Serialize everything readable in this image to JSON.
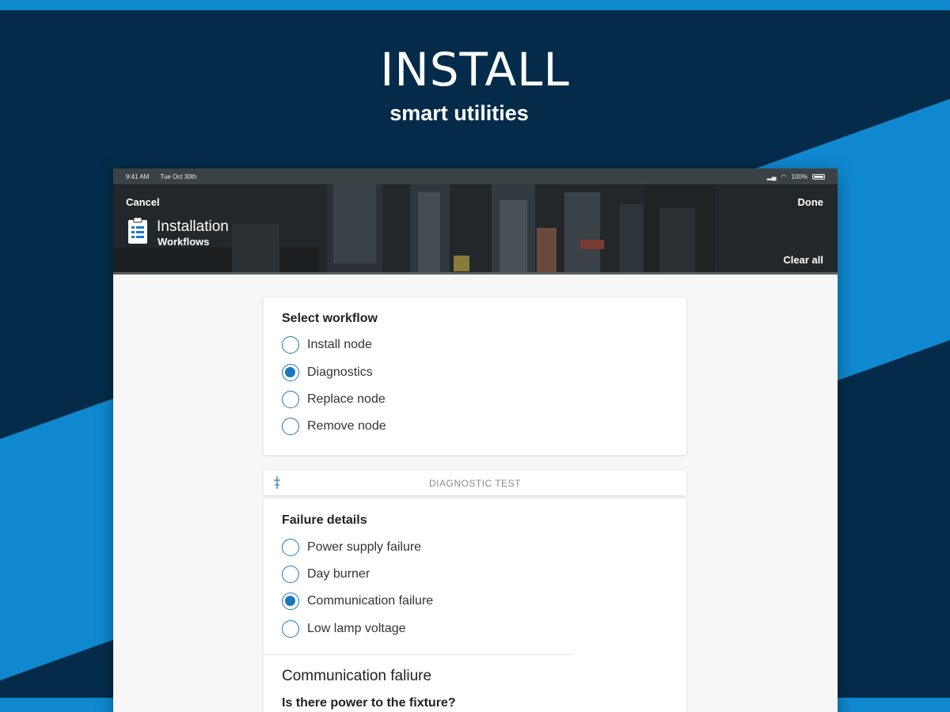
{
  "hero": {
    "title": "INSTALL",
    "subtitle": "smart utilities"
  },
  "status_bar": {
    "time": "9:41 AM",
    "date": "Tue Oct 30th",
    "battery": "100%"
  },
  "header": {
    "cancel_label": "Cancel",
    "done_label": "Done",
    "clear_label": "Clear all",
    "title_line1": "Installation",
    "title_line2": "Workflows",
    "icon": "clipboard-icon"
  },
  "workflow": {
    "title": "Select workflow",
    "options": [
      {
        "label": "Install node",
        "checked": false
      },
      {
        "label": "Diagnostics",
        "checked": true
      },
      {
        "label": "Replace node",
        "checked": false
      },
      {
        "label": "Remove node",
        "checked": false
      }
    ]
  },
  "diagnostic_section": {
    "label": "DIAGNOSTIC TEST",
    "icon": "sliders-icon"
  },
  "failure": {
    "title": "Failure details",
    "options": [
      {
        "label": "Power supply failure",
        "checked": false
      },
      {
        "label": "Day burner",
        "checked": false
      },
      {
        "label": "Communication failure",
        "checked": true
      },
      {
        "label": "Low lamp voltage",
        "checked": false
      }
    ]
  },
  "communication": {
    "title": "Communication faliure",
    "question": "Is there power to the fixture?"
  },
  "colors": {
    "dark_navy": "#042c4a",
    "accent_blue": "#1088d0",
    "radio_blue": "#1a78c2"
  }
}
